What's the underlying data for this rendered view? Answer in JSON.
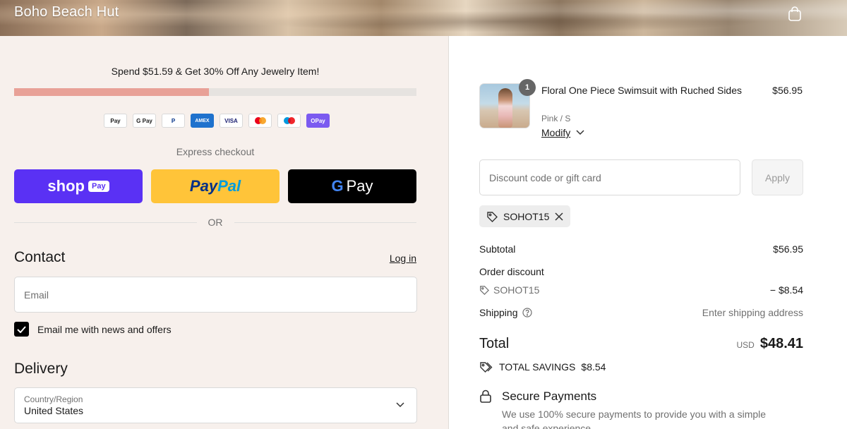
{
  "header": {
    "brand": "Boho Beach Hut"
  },
  "promo": {
    "text": "Spend $51.59 & Get 30% Off Any Jewelry Item!",
    "progress": 0.485
  },
  "payment_icons": [
    "Apple Pay",
    "G Pay",
    "PayPal",
    "AMEX",
    "VISA",
    "Mastercard",
    "Maestro",
    "OPay"
  ],
  "express": {
    "label": "Express checkout",
    "shop_pay": "shop",
    "shop_pay_tag": "Pay",
    "paypal_a": "Pay",
    "paypal_b": "Pal",
    "gpay_g": "G",
    "gpay_label": "Pay",
    "or": "OR"
  },
  "contact": {
    "title": "Contact",
    "login": "Log in",
    "email_placeholder": "Email",
    "newsletter_label": "Email me with news and offers"
  },
  "delivery": {
    "title": "Delivery",
    "country_label": "Country/Region",
    "country_value": "United States"
  },
  "item": {
    "quantity": "1",
    "title": "Floral One Piece Swimsuit with Ruched Sides",
    "variant": "Pink / S",
    "modify": "Modify",
    "price": "$56.95"
  },
  "discount": {
    "placeholder": "Discount code or gift card",
    "apply": "Apply",
    "applied_code": "SOHOT15"
  },
  "summary": {
    "subtotal_label": "Subtotal",
    "subtotal_value": "$56.95",
    "order_discount_label": "Order discount",
    "discount_code": "SOHOT15",
    "discount_value": "− $8.54",
    "shipping_label": "Shipping",
    "shipping_value": "Enter shipping address",
    "total_label": "Total",
    "currency": "USD",
    "total_value": "$48.41",
    "savings_label": "TOTAL SAVINGS",
    "savings_value": "$8.54"
  },
  "secure": {
    "title": "Secure Payments",
    "text": "We use 100% secure payments to provide you with a simple and safe experience."
  },
  "colors": {
    "shop_pay": "#5a31f4",
    "paypal": "#ffc439",
    "progress_fill": "#e8a197",
    "left_bg": "#f7f0ec"
  }
}
